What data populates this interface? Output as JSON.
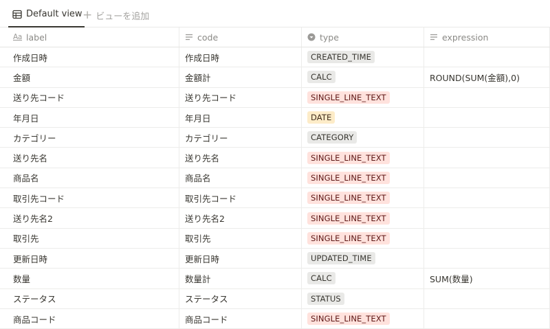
{
  "view_bar": {
    "active_view_label": "Default view",
    "add_view_label": "ビューを追加"
  },
  "columns": [
    {
      "label": "label",
      "icon": "title-text-icon"
    },
    {
      "label": "code",
      "icon": "text-lines-icon"
    },
    {
      "label": "type",
      "icon": "select-icon"
    },
    {
      "label": "expression",
      "icon": "text-lines-icon"
    }
  ],
  "tag_colors": {
    "gray": "#e9e9e7",
    "red": "#ffe2dd",
    "yellow": "#fdecc8"
  },
  "rows": [
    {
      "label": "作成日時",
      "code": "作成日時",
      "type": "CREATED_TIME",
      "type_color": "gray",
      "expression": ""
    },
    {
      "label": "金額",
      "code": "金額計",
      "type": "CALC",
      "type_color": "gray",
      "expression": "ROUND(SUM(金額),0)"
    },
    {
      "label": "送り先コード",
      "code": "送り先コード",
      "type": "SINGLE_LINE_TEXT",
      "type_color": "red",
      "expression": ""
    },
    {
      "label": "年月日",
      "code": "年月日",
      "type": "DATE",
      "type_color": "yellow",
      "expression": ""
    },
    {
      "label": "カテゴリー",
      "code": "カテゴリー",
      "type": "CATEGORY",
      "type_color": "gray",
      "expression": ""
    },
    {
      "label": "送り先名",
      "code": "送り先名",
      "type": "SINGLE_LINE_TEXT",
      "type_color": "red",
      "expression": ""
    },
    {
      "label": "商品名",
      "code": "商品名",
      "type": "SINGLE_LINE_TEXT",
      "type_color": "red",
      "expression": ""
    },
    {
      "label": "取引先コード",
      "code": "取引先コード",
      "type": "SINGLE_LINE_TEXT",
      "type_color": "red",
      "expression": ""
    },
    {
      "label": "送り先名2",
      "code": "送り先名2",
      "type": "SINGLE_LINE_TEXT",
      "type_color": "red",
      "expression": ""
    },
    {
      "label": "取引先",
      "code": "取引先",
      "type": "SINGLE_LINE_TEXT",
      "type_color": "red",
      "expression": ""
    },
    {
      "label": "更新日時",
      "code": "更新日時",
      "type": "UPDATED_TIME",
      "type_color": "gray",
      "expression": ""
    },
    {
      "label": "数量",
      "code": "数量計",
      "type": "CALC",
      "type_color": "gray",
      "expression": "SUM(数量)"
    },
    {
      "label": "ステータス",
      "code": "ステータス",
      "type": "STATUS",
      "type_color": "gray",
      "expression": ""
    },
    {
      "label": "商品コード",
      "code": "商品コード",
      "type": "SINGLE_LINE_TEXT",
      "type_color": "red",
      "expression": ""
    }
  ]
}
